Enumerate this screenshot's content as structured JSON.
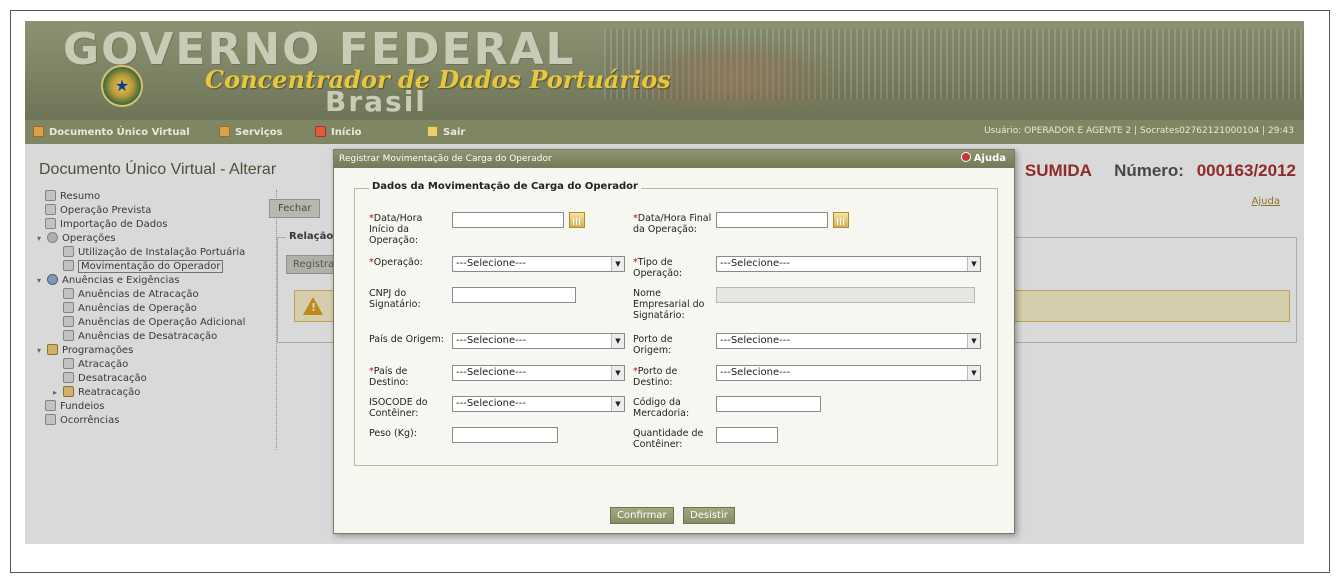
{
  "banner": {
    "title_line1": "GOVERNO FEDERAL",
    "title_line2": "Concentrador de Dados Portuários",
    "title_line3": "Brasil"
  },
  "menubar": {
    "items": [
      {
        "label": "Documento Único Virtual",
        "icon": "document-icon"
      },
      {
        "label": "Serviços",
        "icon": "services-icon"
      },
      {
        "label": "Início",
        "icon": "home-icon"
      },
      {
        "label": "Sair",
        "icon": "exit-icon"
      }
    ],
    "user_info": "Usuário: OPERADOR E AGENTE 2   | Socrates02762121000104 |   29:43"
  },
  "main": {
    "title": "Documento Único Virtual - Alterar",
    "status_fragment": "SUMIDA",
    "number_label": "Número:",
    "number_value": "000163/2012",
    "close_button": "Fechar",
    "help_link": "Ajuda",
    "relation_legend": "Relação",
    "register_button": "Registra"
  },
  "sidebar": {
    "items": [
      {
        "label": "Resumo",
        "icon": "page-icon",
        "level": 0
      },
      {
        "label": "Operação Prevista",
        "icon": "page-icon",
        "level": 0
      },
      {
        "label": "Importação de Dados",
        "icon": "page-icon",
        "level": 0
      },
      {
        "label": "Operações",
        "icon": "gear-icon",
        "level": 0,
        "expanded": true
      },
      {
        "label": "Utilização de Instalação Portuária",
        "icon": "page-icon",
        "level": 1
      },
      {
        "label": "Movimentação do Operador",
        "icon": "page-icon",
        "level": 1,
        "selected": true
      },
      {
        "label": "Anuências e Exigências",
        "icon": "magnifier-icon",
        "level": 0,
        "expanded": true
      },
      {
        "label": "Anuências de Atracação",
        "icon": "page-icon",
        "level": 1
      },
      {
        "label": "Anuências de Operação",
        "icon": "page-icon",
        "level": 1
      },
      {
        "label": "Anuências de Operação Adicional",
        "icon": "page-icon",
        "level": 1
      },
      {
        "label": "Anuências de Desatracação",
        "icon": "page-icon",
        "level": 1
      },
      {
        "label": "Programações",
        "icon": "calendar-icon",
        "level": 0,
        "expanded": true
      },
      {
        "label": "Atracação",
        "icon": "page-icon",
        "level": 1
      },
      {
        "label": "Desatracação",
        "icon": "page-icon",
        "level": 1
      },
      {
        "label": "Reatracação",
        "icon": "calendar-icon",
        "level": 1,
        "collapsed": true
      },
      {
        "label": "Fundeios",
        "icon": "page-icon",
        "level": 0
      },
      {
        "label": "Ocorrências",
        "icon": "page-icon",
        "level": 0
      }
    ]
  },
  "modal": {
    "title": "Registrar Movimentação de Carga do Operador",
    "help": "Ajuda",
    "legend": "Dados da Movimentação de Carga do Operador",
    "fields": {
      "data_inicio": {
        "label": "Data/Hora Início da Operação:",
        "required": "*",
        "value": ""
      },
      "data_final": {
        "label": "Data/Hora Final da Operação:",
        "required": "*",
        "value": ""
      },
      "operacao": {
        "label": "Operação:",
        "required": "*",
        "value": "---Selecione---"
      },
      "tipo_operacao": {
        "label": "Tipo de Operação:",
        "required": "*",
        "value": "---Selecione---"
      },
      "cnpj": {
        "label": "CNPJ do Signatário:",
        "value": ""
      },
      "nome_empresarial": {
        "label": "Nome Empresarial do Signatário:",
        "value": ""
      },
      "pais_origem": {
        "label": "País de Origem:",
        "value": "---Selecione---"
      },
      "porto_origem": {
        "label": "Porto de Origem:",
        "value": "---Selecione---"
      },
      "pais_destino": {
        "label": "País de Destino:",
        "required": "*",
        "value": "---Selecione---"
      },
      "porto_destino": {
        "label": "Porto de Destino:",
        "required": "*",
        "value": "---Selecione---"
      },
      "isocode": {
        "label": "ISOCODE do Contêiner:",
        "value": "---Selecione---"
      },
      "codigo_mercadoria": {
        "label": "Código da Mercadoria:",
        "value": ""
      },
      "peso": {
        "label": "Peso (Kg):",
        "value": ""
      },
      "quantidade_conteiner": {
        "label": "Quantidade de Contêiner:",
        "value": ""
      }
    },
    "confirm_button": "Confirmar",
    "cancel_button": "Desistir"
  }
}
